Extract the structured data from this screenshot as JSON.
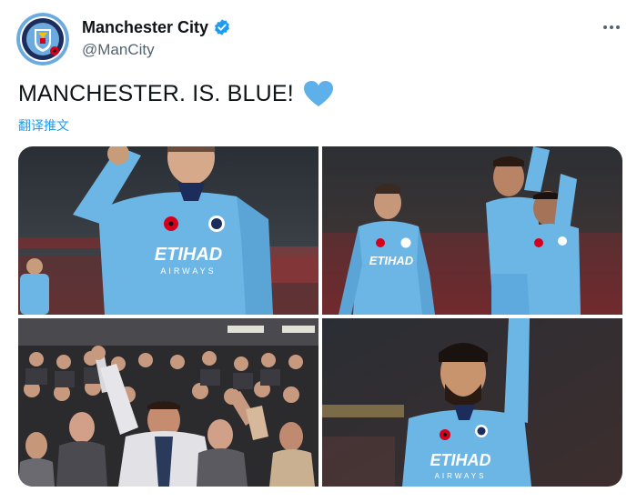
{
  "author": {
    "display_name": "Manchester City",
    "handle": "@ManCity",
    "verified": true,
    "avatar_icon": "manchester-city-crest"
  },
  "tweet": {
    "text": "MANCHESTER. IS. BLUE!",
    "emoji": "light-blue-heart",
    "translate_label": "翻译推文"
  },
  "media": {
    "photos": [
      {
        "desc": "player-in-sky-blue-kit-raising-fist",
        "sponsor": "ETIHAD",
        "sponsor_sub": "AIRWAYS"
      },
      {
        "desc": "three-players-in-sky-blue-kit-celebrating",
        "sponsor": "ETIHAD"
      },
      {
        "desc": "fans-in-stands-cheering"
      },
      {
        "desc": "bearded-player-raising-arm",
        "sponsor": "ETIHAD",
        "sponsor_sub": "AIRWAYS"
      }
    ]
  },
  "colors": {
    "kit_blue": "#6cb6e6",
    "link_blue": "#1d9bf0",
    "heart_blue": "#5db0ea",
    "secondary_text": "#536471"
  }
}
